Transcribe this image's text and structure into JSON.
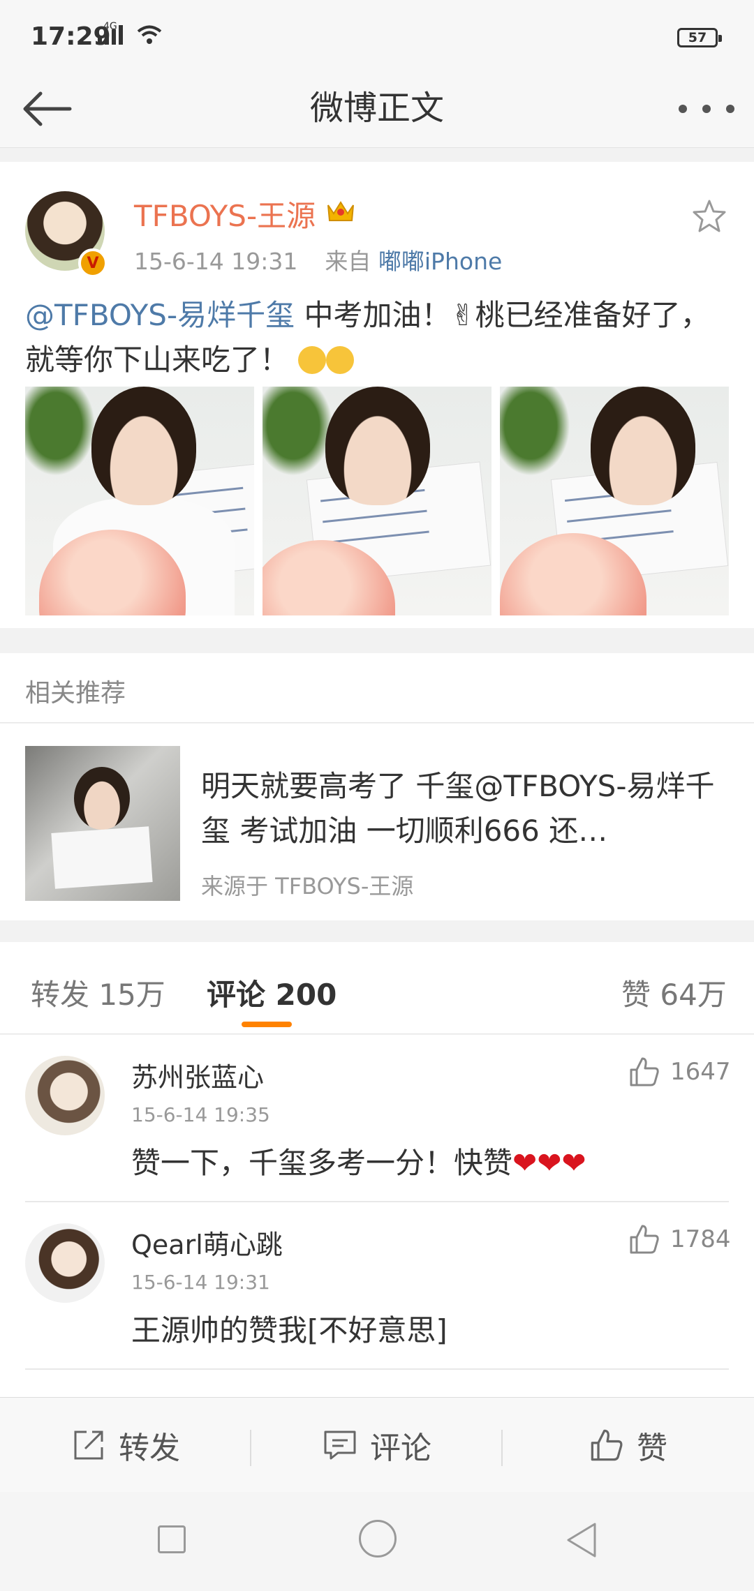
{
  "status_bar": {
    "time": "17:29",
    "network": "4G",
    "battery": "57"
  },
  "nav": {
    "title": "微博正文"
  },
  "post": {
    "username": "TFBOYS-王源",
    "timestamp": "15-6-14 19:31",
    "source_prefix": "来自",
    "source": "嘟嘟iPhone",
    "mention": "@TFBOYS-易烊千玺",
    "text_part1": " 中考加油！✌桃已经准备好了，就等你下山来吃了！",
    "colors": {
      "username": "#eb7350",
      "link": "#4e7aa8"
    }
  },
  "related": {
    "header": "相关推荐",
    "title": "明天就要高考了 千玺@TFBOYS-易烊千玺 考试加油 一切顺利666 还…",
    "source": "来源于 TFBOYS-王源"
  },
  "tabs": {
    "repost": "转发 15万",
    "comment": "评论 200",
    "like": "赞 64万",
    "accent": "#ff8200"
  },
  "comments": [
    {
      "name": "苏州张蓝心",
      "time": "15-6-14 19:35",
      "text": "赞一下，千玺多考一分！快赞",
      "hearts": "❤❤❤",
      "likes": "1647"
    },
    {
      "name": "Qearl萌心跳",
      "time": "15-6-14 19:31",
      "text": "王源帅的赞我[不好意思]",
      "likes": "1784"
    }
  ],
  "toolbar": {
    "repost": "转发",
    "comment": "评论",
    "like": "赞"
  },
  "icons": [
    "back-arrow-icon",
    "more-icon",
    "crown-icon",
    "star-icon",
    "verified-icon",
    "thumbs-up-icon",
    "repost-icon",
    "comment-icon"
  ]
}
